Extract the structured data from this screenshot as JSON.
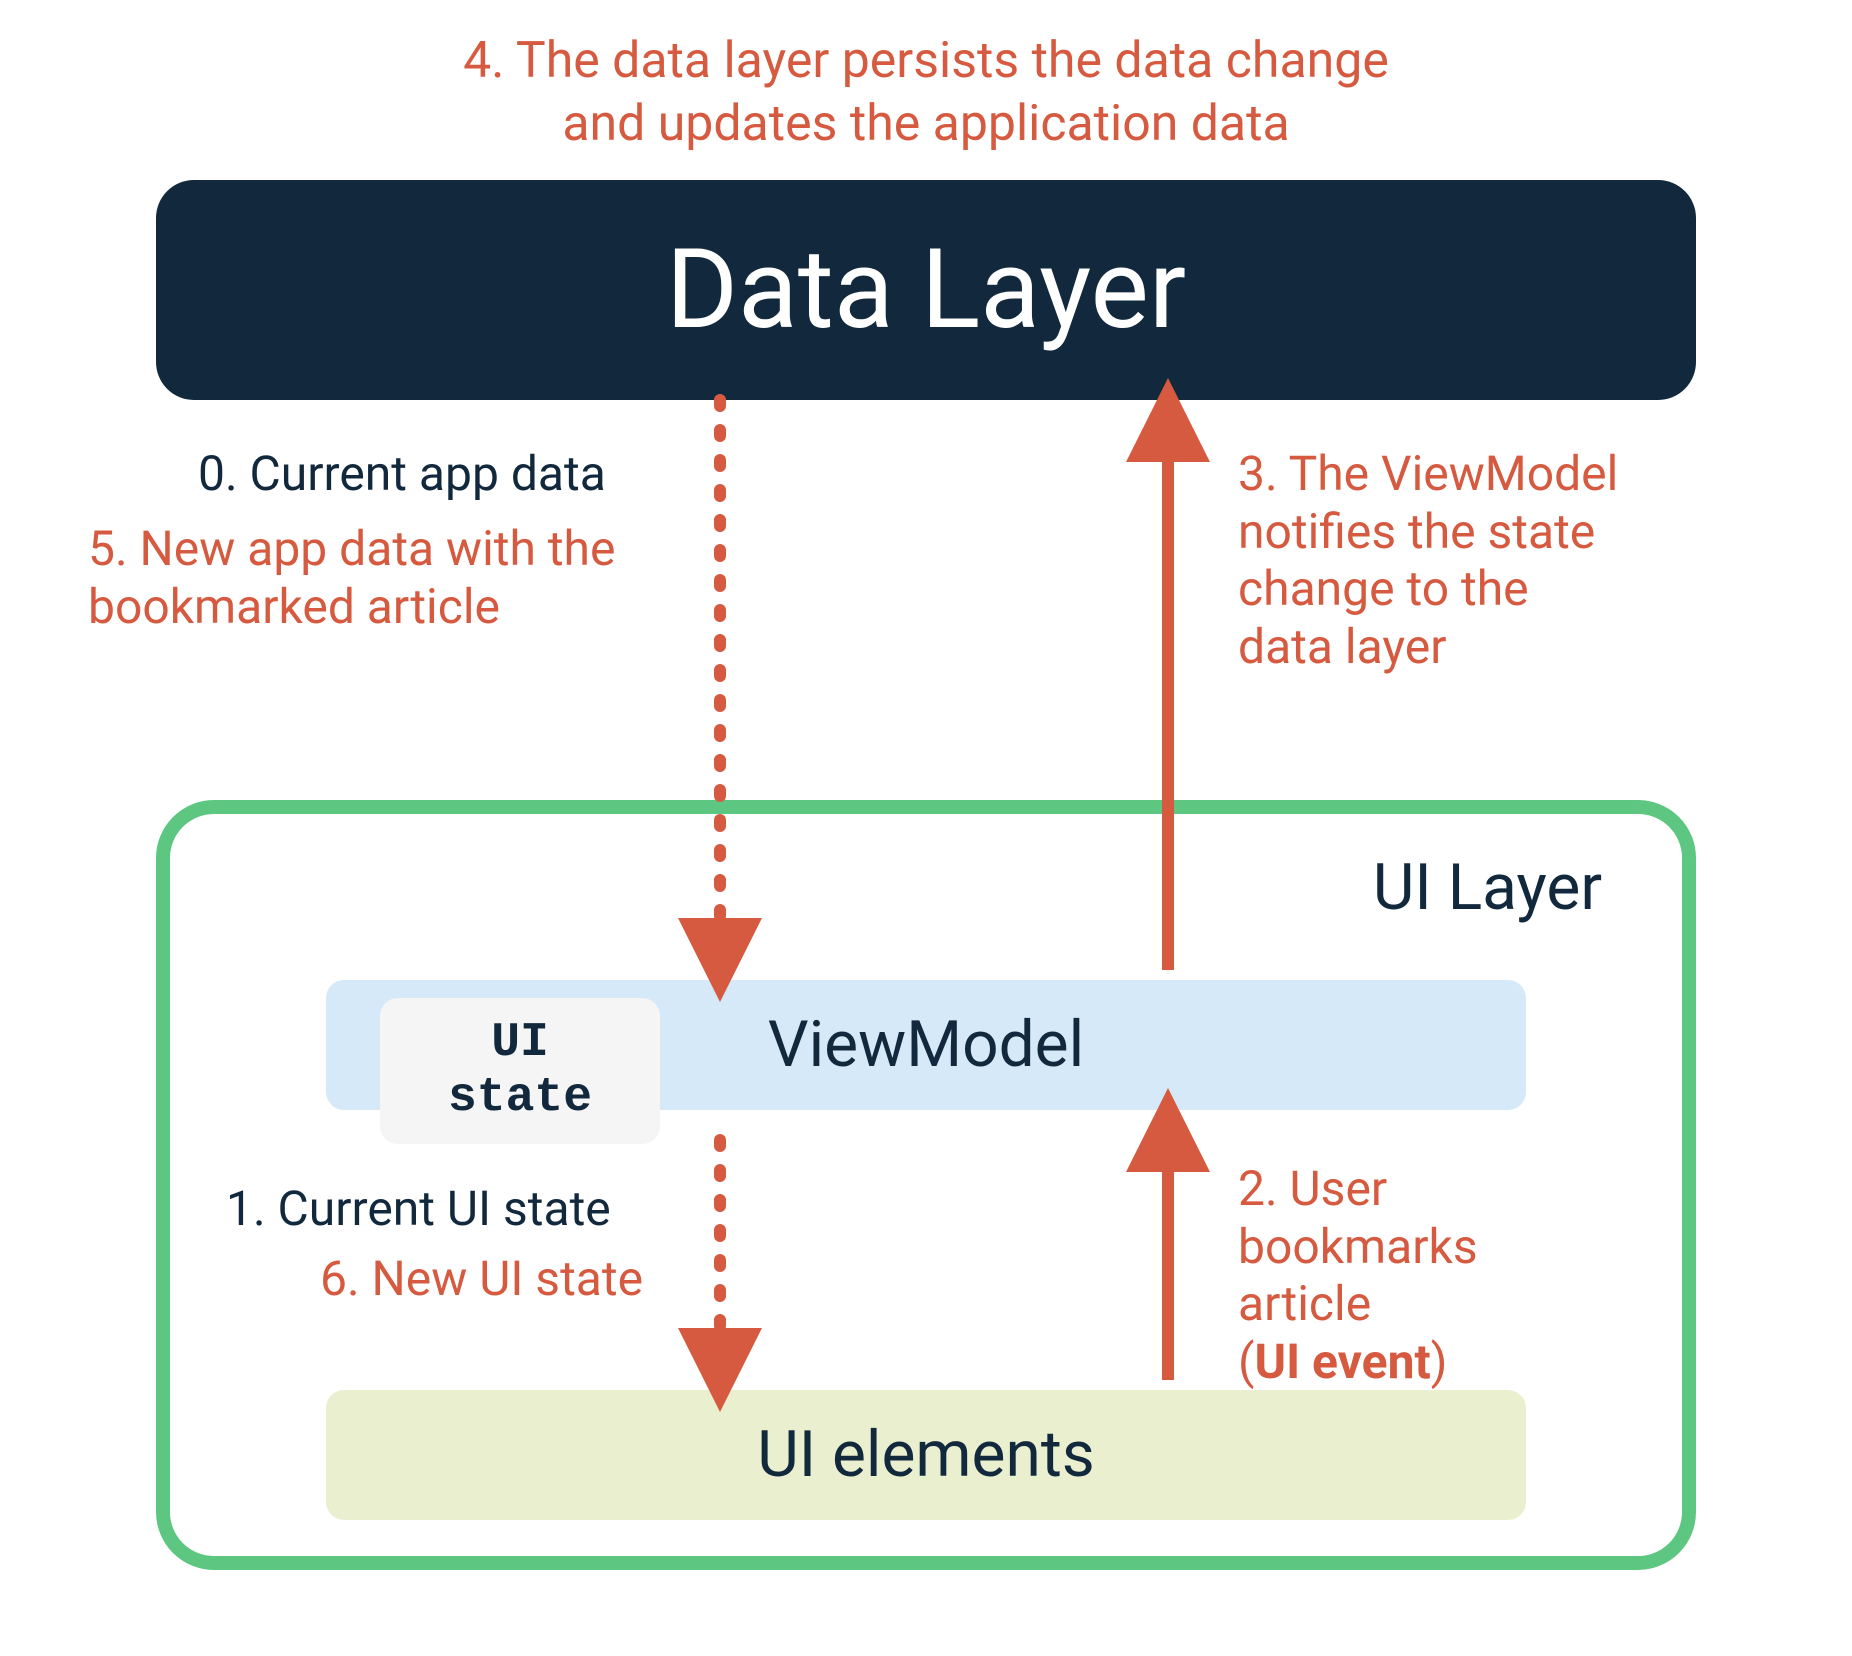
{
  "top_annotation": {
    "line1": "4. The data layer persists the data change",
    "line2": "and updates the application data"
  },
  "data_layer": {
    "label": "Data Layer"
  },
  "ui_layer": {
    "label": "UI Layer"
  },
  "viewmodel": {
    "label": "ViewModel"
  },
  "ui_state": {
    "line1": "UI",
    "line2": "state"
  },
  "ui_elements": {
    "label": "UI elements"
  },
  "labels": {
    "step0": "0. Current app data",
    "step5_line1": "5. New app data with the",
    "step5_line2": "bookmarked article",
    "step3_line1": "3. The ViewModel",
    "step3_line2": "notifies the state",
    "step3_line3": "change to the",
    "step3_line4": "data layer",
    "step1": "1. Current UI state",
    "step6": "6. New UI state",
    "step2_line1": "2. User",
    "step2_line2": "bookmarks",
    "step2_line3": "article",
    "step2_line4a": "(",
    "step2_line4b": "UI event",
    "step2_line4c": ")"
  },
  "colors": {
    "accent": "#d65a3f",
    "dark": "#12293d",
    "green": "#5dc781",
    "lightblue": "#d5e9f8",
    "lightgreen": "#eaf0cf",
    "gray": "#f5f5f5"
  }
}
